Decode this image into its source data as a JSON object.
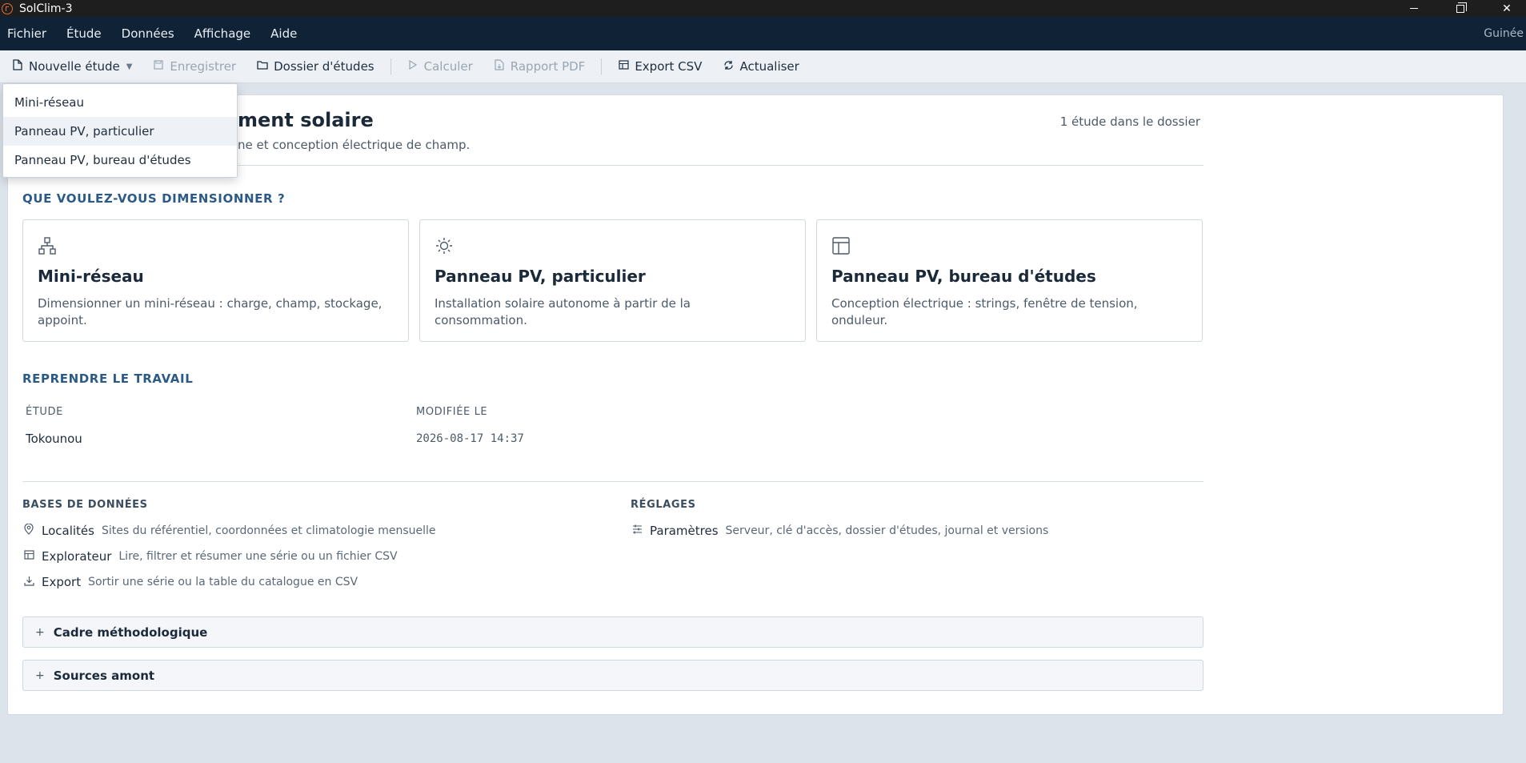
{
  "window": {
    "title": "SolClim-3"
  },
  "menubar": {
    "items": [
      "Fichier",
      "Étude",
      "Données",
      "Affichage",
      "Aide"
    ],
    "region": "Guinée"
  },
  "toolbar": {
    "new_study": "Nouvelle étude",
    "save": "Enregistrer",
    "studies_folder": "Dossier d'études",
    "compute": "Calculer",
    "pdf_report": "Rapport PDF",
    "export_csv": "Export CSV",
    "refresh": "Actualiser"
  },
  "dropdown": {
    "items": [
      "Mini-réseau",
      "Panneau PV, particulier",
      "Panneau PV, bureau d'études"
    ],
    "hovered_index": 1
  },
  "header": {
    "title_visible": "ment solaire",
    "subtitle_visible": "ne et conception électrique de champ.",
    "study_count": "1 étude dans le dossier"
  },
  "sizing": {
    "heading": "QUE VOULEZ-VOUS DIMENSIONNER ?",
    "cards": [
      {
        "icon": "network-icon",
        "title": "Mini-réseau",
        "desc": "Dimensionner un mini-réseau : charge, champ, stockage, appoint."
      },
      {
        "icon": "sun-icon",
        "title": "Panneau PV, particulier",
        "desc": "Installation solaire autonome à partir de la consommation."
      },
      {
        "icon": "layout-icon",
        "title": "Panneau PV, bureau d'études",
        "desc": "Conception électrique : strings, fenêtre de tension, onduleur."
      }
    ]
  },
  "resume": {
    "heading": "REPRENDRE LE TRAVAIL",
    "columns": [
      "ÉTUDE",
      "MODIFIÉE LE"
    ],
    "rows": [
      {
        "study": "Tokounou",
        "modified": "2026-08-17 14:37"
      }
    ]
  },
  "databases": {
    "heading": "BASES DE DONNÉES",
    "items": [
      {
        "icon": "pin-icon",
        "name": "Localités",
        "desc": "Sites du référentiel, coordonnées et climatologie mensuelle"
      },
      {
        "icon": "table-icon",
        "name": "Explorateur",
        "desc": "Lire, filtrer et résumer une série ou un fichier CSV"
      },
      {
        "icon": "download-icon",
        "name": "Export",
        "desc": "Sortir une série ou la table du catalogue en CSV"
      }
    ]
  },
  "settings": {
    "heading": "RÉGLAGES",
    "items": [
      {
        "icon": "sliders-icon",
        "name": "Paramètres",
        "desc": "Serveur, clé d'accès, dossier d'études, journal et versions"
      }
    ]
  },
  "accordions": [
    "Cadre méthodologique",
    "Sources amont"
  ]
}
